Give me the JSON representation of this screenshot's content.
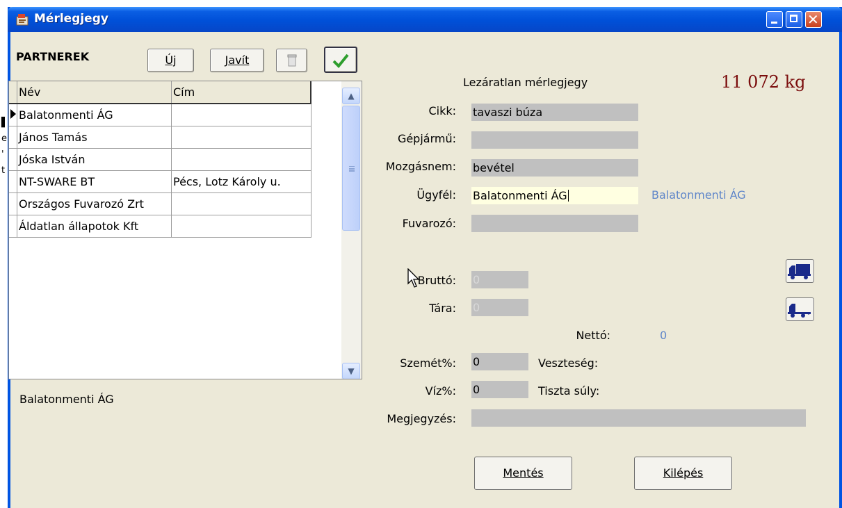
{
  "window": {
    "title": "Mérlegjegy"
  },
  "background_text": [
    "e",
    "'",
    "t"
  ],
  "partners": {
    "heading": "PARTNEREK",
    "new_button": "Új",
    "edit_button": "Javít",
    "delete_icon": "trash-icon",
    "confirm_icon": "checkmark-icon",
    "columns": [
      "Név",
      "Cím"
    ],
    "rows": [
      {
        "name": "Balatonmenti ÁG",
        "address": ""
      },
      {
        "name": "János Tamás",
        "address": ""
      },
      {
        "name": "Jóska István",
        "address": ""
      },
      {
        "name": "NT-SWARE BT",
        "address": "Pécs, Lotz Károly u."
      },
      {
        "name": "Országos Fuvarozó Zrt",
        "address": ""
      },
      {
        "name": "Áldatlan állapotok Kft",
        "address": ""
      }
    ],
    "selected_row": 0,
    "selected_name": "Balatonmenti ÁG"
  },
  "ticket": {
    "status": "Lezáratlan mérlegjegy",
    "weight": "11 072 kg",
    "labels": {
      "cikk": "Cikk:",
      "gepjarmu": "Gépjármű:",
      "mozgasnem": "Mozgásnem:",
      "ugyfel": "Ügyfél:",
      "fuvarozo": "Fuvarozó:",
      "brutto": "Bruttó:",
      "tara": "Tára:",
      "netto": "Nettó:",
      "szemet": "Szemét%:",
      "veszteseg": "Veszteség:",
      "viz": "Víz%:",
      "tiszta": "Tiszta súly:",
      "megjegyzes": "Megjegyzés:"
    },
    "values": {
      "cikk": "tavaszi búza",
      "gepjarmu": "",
      "mozgasnem": "bevétel",
      "ugyfel": "Balatonmenti ÁG",
      "ugyfel_display": "Balatonmenti ÁG",
      "fuvarozo": "",
      "brutto": "0",
      "tara": "0",
      "netto": "0",
      "szemet": "0",
      "viz": "0",
      "megjegyzes": ""
    },
    "icons": {
      "brutto_weigh": "loaded-truck-icon",
      "tara_weigh": "empty-truck-icon"
    }
  },
  "actions": {
    "save": "Mentés",
    "exit": "Kilépés"
  },
  "colors": {
    "titlebar": "#0050d8",
    "weight_text": "#7a0c0c",
    "link_blue": "#5f86c9",
    "field_gray": "#c0c0c0",
    "field_active": "#ffffe1",
    "window_bg": "#ece9d8"
  }
}
